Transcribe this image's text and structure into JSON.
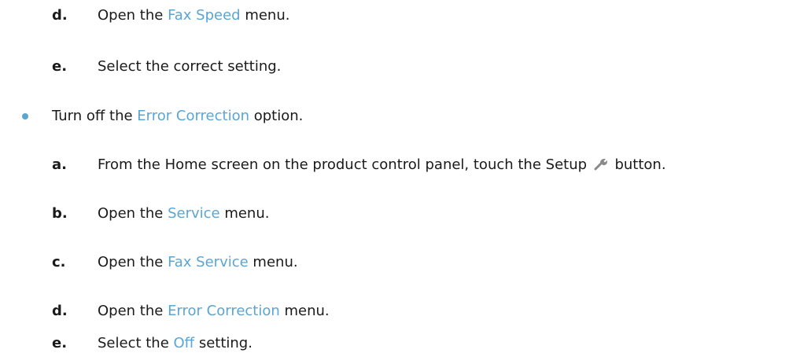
{
  "step_d1": {
    "letter": "d.",
    "pre": "Open the ",
    "link": "Fax Speed",
    "post": " menu."
  },
  "step_e1": {
    "letter": "e.",
    "text": "Select the correct setting."
  },
  "bullet": {
    "pre": "Turn off the ",
    "link": "Error Correction",
    "post": " option."
  },
  "step_a": {
    "letter": "a.",
    "pre": "From the Home screen on the product control panel, touch the Setup ",
    "post": " button.",
    "icon": "wrench-icon"
  },
  "step_b": {
    "letter": "b.",
    "pre": "Open the ",
    "link": "Service",
    "post": " menu."
  },
  "step_c": {
    "letter": "c.",
    "pre": "Open the ",
    "link": "Fax Service",
    "post": " menu."
  },
  "step_d2": {
    "letter": "d.",
    "pre": "Open the ",
    "link": "Error Correction",
    "post": " menu."
  },
  "step_e2": {
    "letter": "e.",
    "pre": "Select the ",
    "link": "Off",
    "post": " setting."
  },
  "colors": {
    "link": "#5aa5d4",
    "text": "#1a1a1a"
  }
}
